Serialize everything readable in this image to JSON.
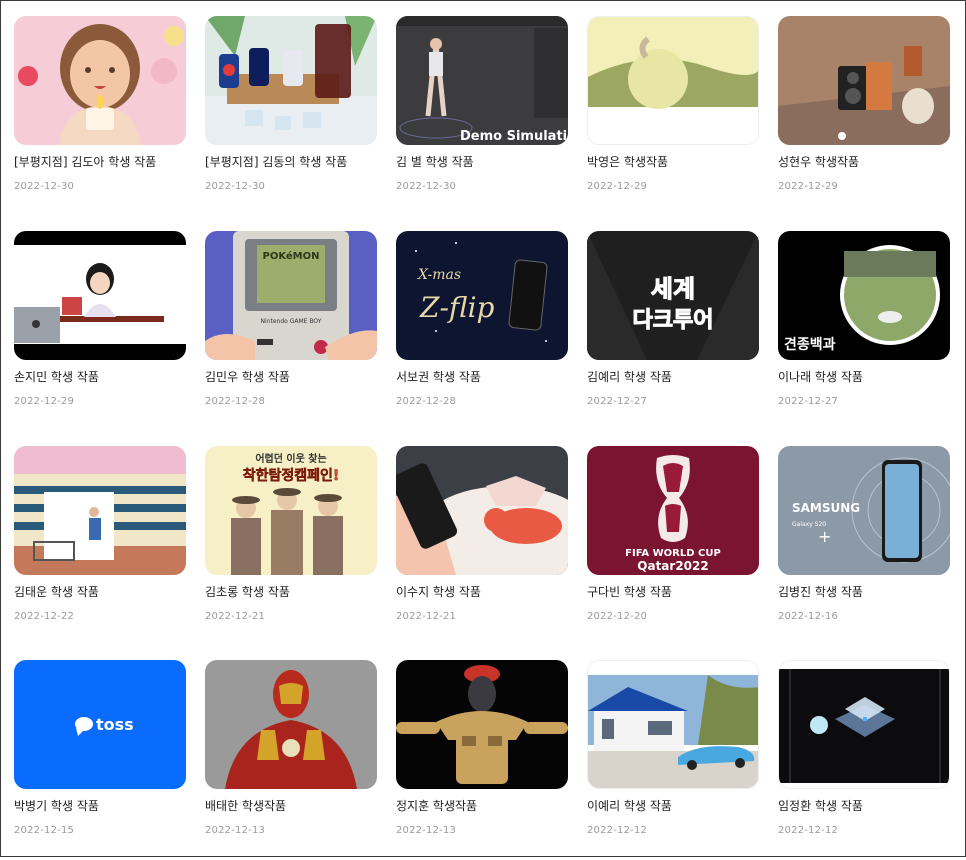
{
  "gallery": {
    "items": [
      {
        "title": "[부평지점] 김도아 학생 작품",
        "date": "2022-12-30",
        "thumb": "candle-girl-illustration"
      },
      {
        "title": "[부평지점] 김동의 학생 작품",
        "date": "2022-12-30",
        "thumb": "soda-cans-ice"
      },
      {
        "title": "김 별 학생 작품",
        "date": "2022-12-30",
        "thumb": "3d-character-rig",
        "overlay": "Demo Simulation"
      },
      {
        "title": "박영은 학생작품",
        "date": "2022-12-29",
        "thumb": "landscape-ring"
      },
      {
        "title": "성현우 학생작품",
        "date": "2022-12-29",
        "thumb": "speaker-room-3d"
      },
      {
        "title": "손지민 학생 작품",
        "date": "2022-12-29",
        "thumb": "girl-laptop-desk"
      },
      {
        "title": "김민우 학생 작품",
        "date": "2022-12-28",
        "thumb": "gameboy-pokemon",
        "overlay": "POKéMON",
        "overlay2": "Nintendo GAME BOY"
      },
      {
        "title": "서보권 학생 작품",
        "date": "2022-12-28",
        "thumb": "x-mas-z-flip",
        "overlay": "X-mas",
        "overlay2": "Z-flip"
      },
      {
        "title": "김예리 학생 작품",
        "date": "2022-12-27",
        "thumb": "world-tour-title",
        "overlay": "세계",
        "overlay2": "다크투어"
      },
      {
        "title": "이나래 학생 작품",
        "date": "2022-12-27",
        "thumb": "dog-circle-photo",
        "overlay": "견종백과"
      },
      {
        "title": "김태운 학생 작품",
        "date": "2022-12-22",
        "thumb": "supermarket-man"
      },
      {
        "title": "김초롱 학생 작품",
        "date": "2022-12-21",
        "thumb": "detectives-campaign",
        "overlay": "어렵던 이웃 찾는",
        "overlay2": "착한탐정캠페인!"
      },
      {
        "title": "이수지 학생 작품",
        "date": "2022-12-21",
        "thumb": "phone-hand-dog"
      },
      {
        "title": "구다빈 학생 작품",
        "date": "2022-12-20",
        "thumb": "fifa-world-cup",
        "overlay": "FIFA WORLD CUP",
        "overlay2": "Qatar2022"
      },
      {
        "title": "김병진 학생 작품",
        "date": "2022-12-16",
        "thumb": "samsung-galaxy",
        "overlay": "SAMSUNG",
        "overlay2": "Galaxy S20"
      },
      {
        "title": "박병기 학생 작품",
        "date": "2022-12-15",
        "thumb": "toss-logo",
        "overlay": "toss"
      },
      {
        "title": "배태한 학생작품",
        "date": "2022-12-13",
        "thumb": "iron-man-3d"
      },
      {
        "title": "정지훈 학생작품",
        "date": "2022-12-13",
        "thumb": "cartoon-character-3d"
      },
      {
        "title": "이예리 학생 작품",
        "date": "2022-12-12",
        "thumb": "house-blue-car"
      },
      {
        "title": "임정환 학생 작품",
        "date": "2022-12-12",
        "thumb": "abstract-glass-3d"
      }
    ]
  }
}
